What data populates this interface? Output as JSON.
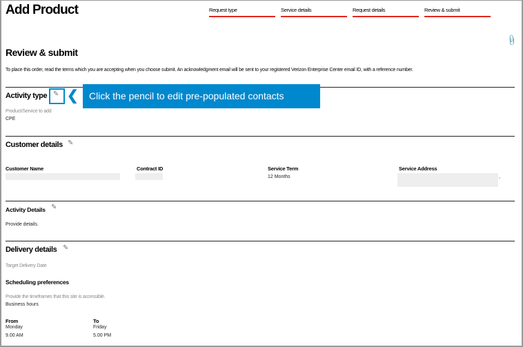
{
  "header": {
    "title": "Add Product",
    "steps": [
      "Request type",
      "Service details",
      "Request details",
      "Review & submit"
    ]
  },
  "review": {
    "title": "Review & submit",
    "intro": "To place this order, read the terms which you are accepting when you choose submit. An acknowledgment email will be sent to your registered Verizon Enterprise Center email ID, with a reference number."
  },
  "activity_type": {
    "title": "Activity type",
    "label": "Product/Service to add",
    "value": "CPE"
  },
  "callout": {
    "text": "Click the pencil to edit pre-populated contacts"
  },
  "customer": {
    "title": "Customer details",
    "columns": [
      {
        "label": "Customer Name"
      },
      {
        "label": "Contract ID"
      },
      {
        "label": "Service Term",
        "value": "12 Months"
      },
      {
        "label": "Service Address",
        "value": ","
      }
    ]
  },
  "activity_details": {
    "title": "Activity Details",
    "value": "Provide details."
  },
  "delivery": {
    "title": "Delivery details",
    "target_label": "Target Delivery Date",
    "sched_title": "Scheduling preferences",
    "sched_hint": "Provide the timeframes that this site is accessible.",
    "sched_value": "Business hours",
    "from_label": "From",
    "from_day": "Monday",
    "from_time": "9.00 AM",
    "to_label": "To",
    "to_day": "Friday",
    "to_time": "5.00 PM"
  }
}
